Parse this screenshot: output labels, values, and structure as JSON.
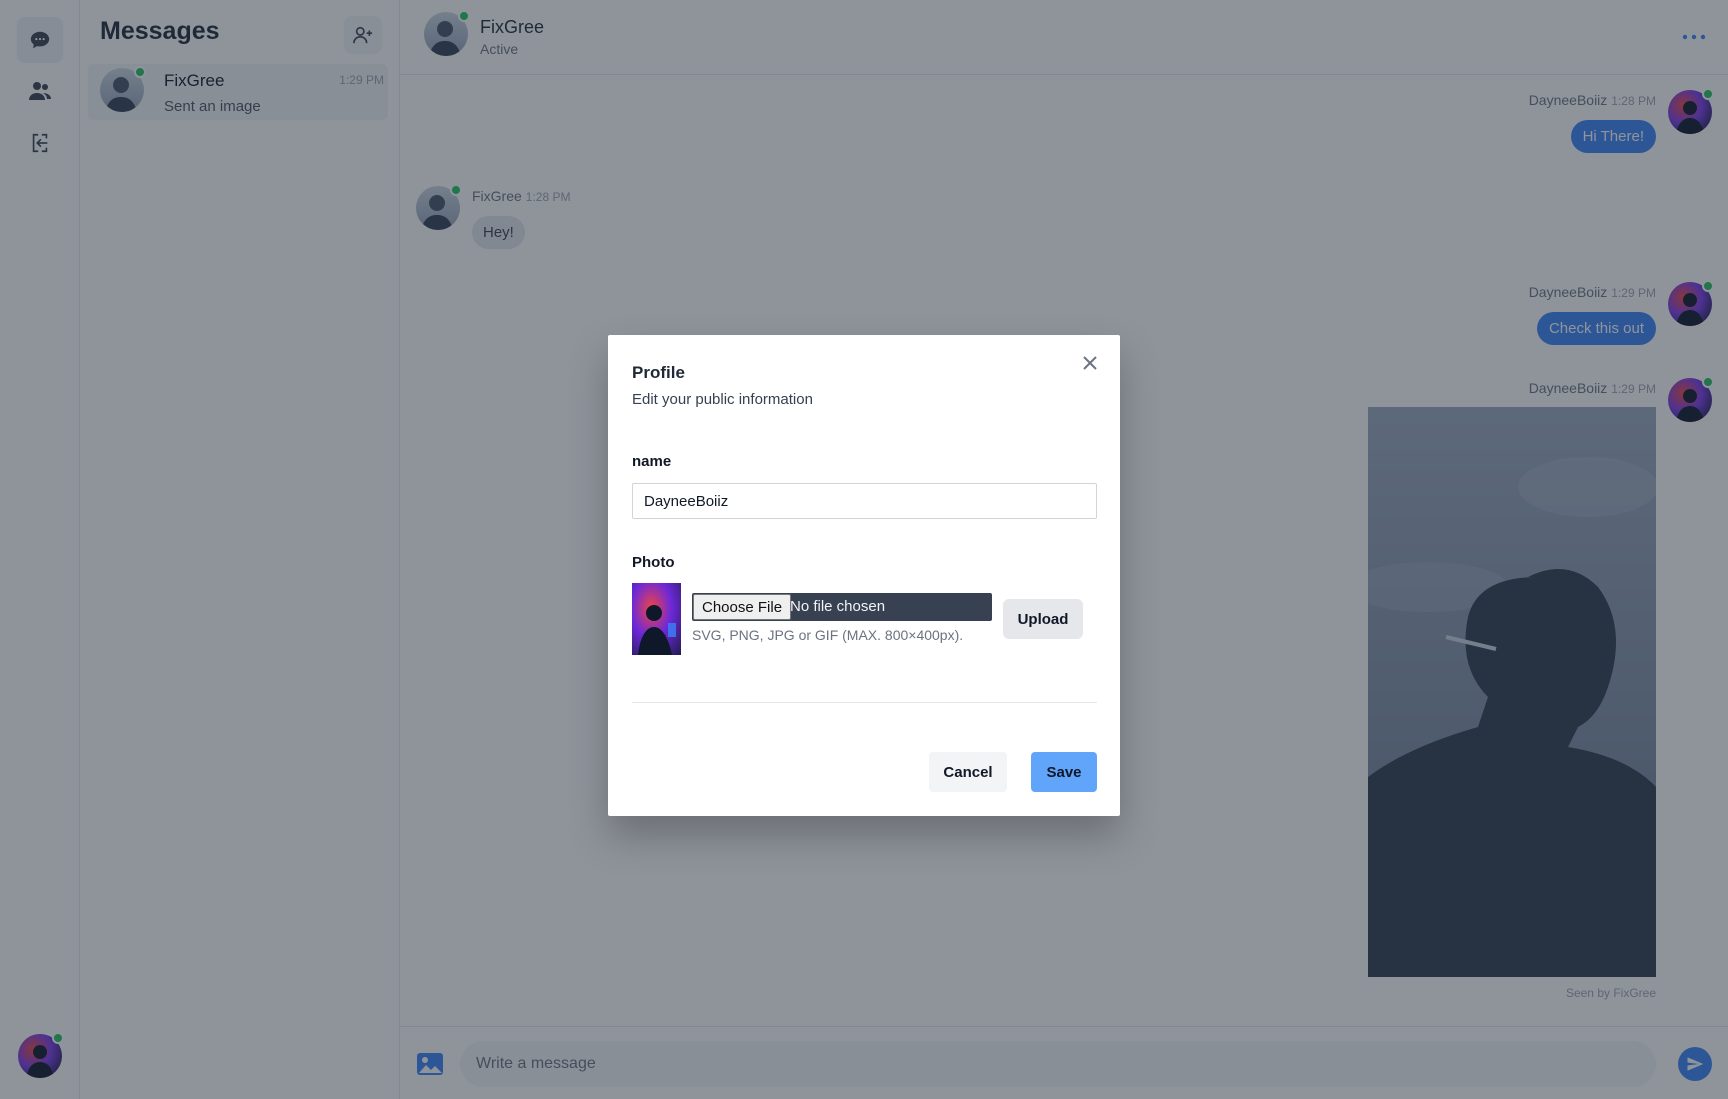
{
  "sidebar": {
    "title": "Messages",
    "conversations": [
      {
        "name": "FixGree",
        "last_message": "Sent an image",
        "time": "1:29 PM"
      }
    ]
  },
  "rail": {
    "icons": [
      "chat-bubble-icon",
      "users-icon",
      "logout-icon"
    ]
  },
  "chat": {
    "contact_name": "FixGree",
    "contact_status": "Active",
    "messages": [
      {
        "sender": "DayneeBoiiz",
        "time": "1:28 PM",
        "text": "Hi There!",
        "direction": "out"
      },
      {
        "sender": "FixGree",
        "time": "1:28 PM",
        "text": "Hey!",
        "direction": "in"
      },
      {
        "sender": "DayneeBoiiz",
        "time": "1:29 PM",
        "text": "Check this out",
        "direction": "out"
      },
      {
        "sender": "DayneeBoiiz",
        "time": "1:29 PM",
        "text": "",
        "direction": "out",
        "kind": "image"
      }
    ],
    "seen_text": "Seen by FixGree"
  },
  "composer": {
    "placeholder": "Write a message"
  },
  "modal": {
    "title": "Profile",
    "subtitle": "Edit your public information",
    "name_label": "name",
    "name_value": "DayneeBoiiz",
    "photo_label": "Photo",
    "choose_file_label": "Choose File",
    "file_status": "No file chosen",
    "file_hint": "SVG, PNG, JPG or GIF (MAX. 800×400px).",
    "upload_label": "Upload",
    "cancel_label": "Cancel",
    "save_label": "Save"
  },
  "colors": {
    "accent": "#3b82f6",
    "save_button": "#60a5fa",
    "online": "#22c55e",
    "overlay": "rgba(31,41,55,0.5)"
  }
}
